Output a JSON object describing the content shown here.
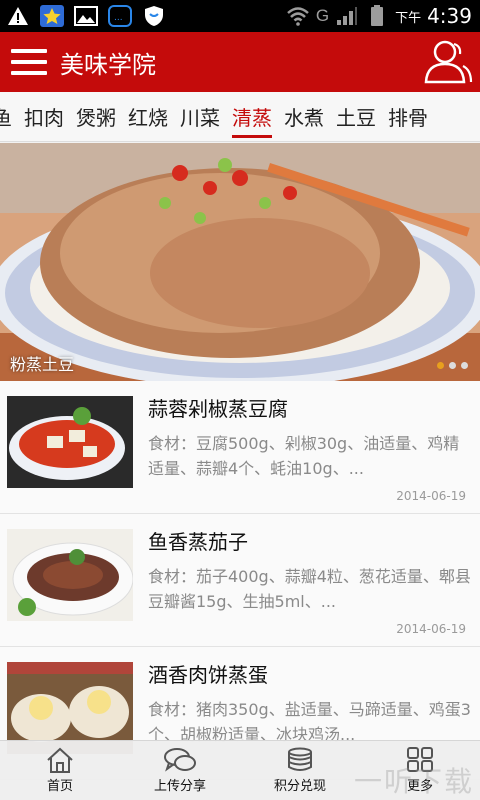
{
  "status_bar": {
    "network": "G",
    "ampm": "下午",
    "time": "4:39"
  },
  "app_bar": {
    "title": "美味学院"
  },
  "tabs": [
    "鱼",
    "扣肉",
    "煲粥",
    "红烧",
    "川菜",
    "清蒸",
    "水煮",
    "土豆",
    "排骨"
  ],
  "active_tab": "清蒸",
  "banner": {
    "caption": "粉蒸土豆",
    "page_count": 3,
    "current_page": 1
  },
  "recipes": [
    {
      "title": "蒜蓉剁椒蒸豆腐",
      "desc": "食材：豆腐500g、剁椒30g、油适量、鸡精适量、蒜瓣4个、蚝油10g、...",
      "date": "2014-06-19"
    },
    {
      "title": "鱼香蒸茄子",
      "desc": "食材：茄子400g、蒜瓣4粒、葱花适量、郫县豆瓣酱15g、生抽5ml、...",
      "date": "2014-06-19"
    },
    {
      "title": "酒香肉饼蒸蛋",
      "desc": "食材：猪肉350g、盐适量、马蹄适量、鸡蛋3个、胡椒粉适量、冰块鸡汤...",
      "date": ""
    }
  ],
  "bottom_nav": {
    "home": "首页",
    "upload": "上传分享",
    "points": "积分兑现",
    "more": "更多"
  },
  "watermark": "一听下载",
  "colors": {
    "brand_red": "#c40b0b",
    "dot_active": "#e8a01e"
  }
}
